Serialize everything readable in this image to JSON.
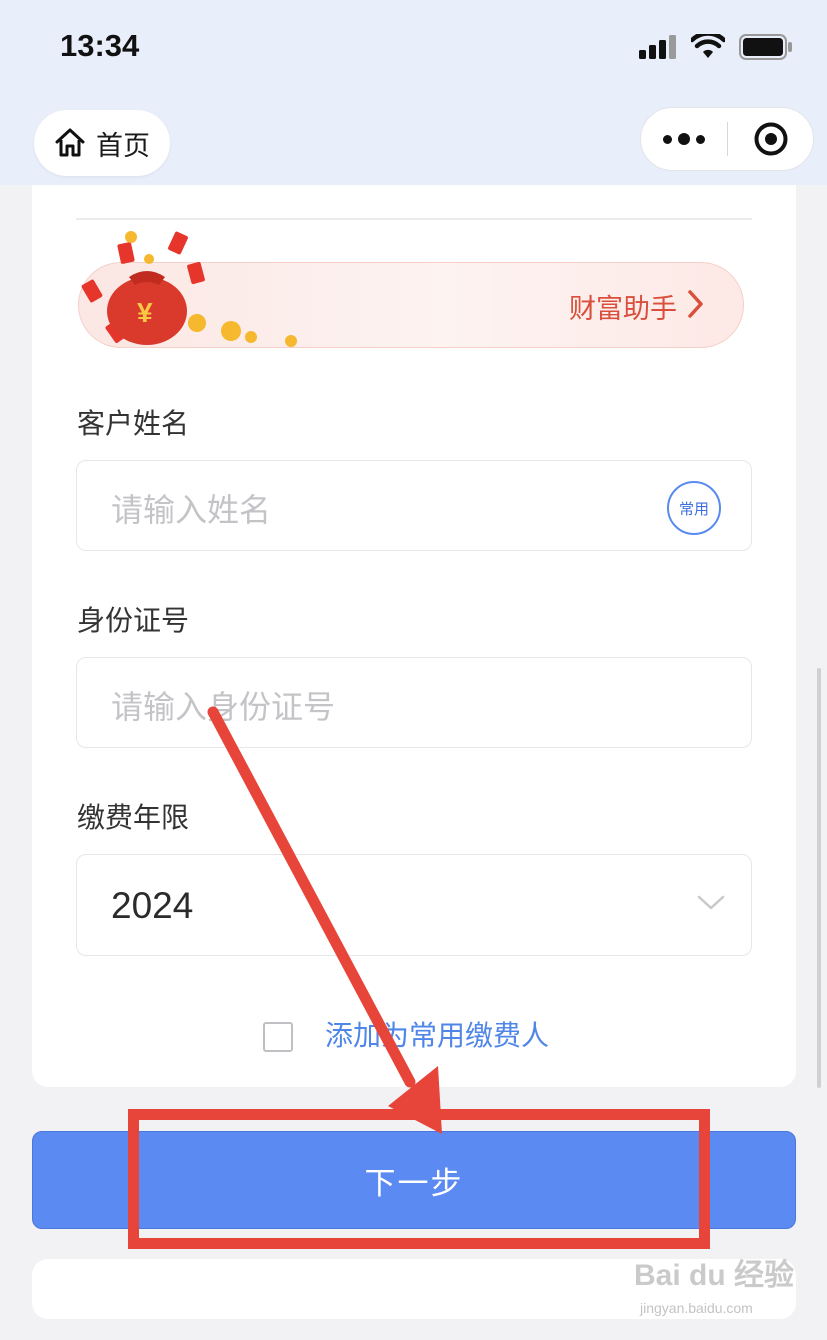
{
  "status_bar": {
    "time": "13:34"
  },
  "nav": {
    "home_label": "首页"
  },
  "banner": {
    "label": "财富助手"
  },
  "form": {
    "name": {
      "label": "客户姓名",
      "placeholder": "请输入姓名",
      "badge": "常用"
    },
    "id_number": {
      "label": "身份证号",
      "placeholder": "请输入身份证号"
    },
    "payment_year": {
      "label": "缴费年限",
      "value": "2024"
    },
    "add_common": {
      "label": "添加为常用缴费人"
    }
  },
  "actions": {
    "next_label": "下一步"
  },
  "watermark": {
    "text": "Bai du 经验",
    "sub": "jingyan.baidu.com"
  },
  "colors": {
    "primary": "#5b8af3",
    "annotation": "#e8453a",
    "link": "#4f86e8"
  }
}
